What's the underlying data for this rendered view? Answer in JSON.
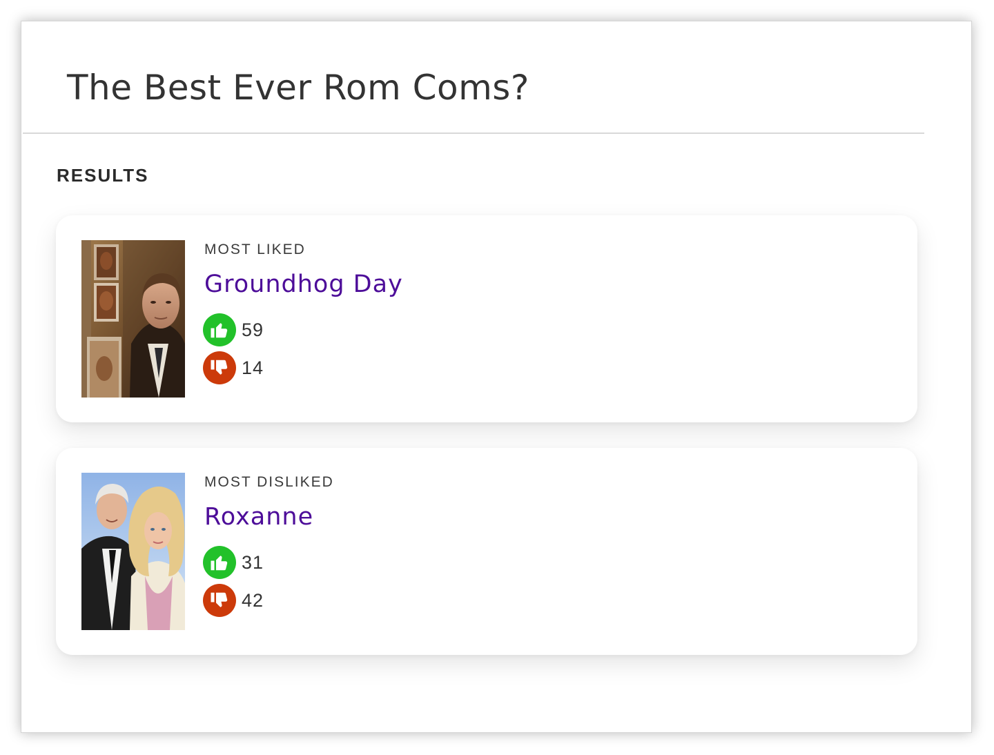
{
  "page": {
    "title": "The Best Ever Rom Coms?",
    "results_label": "RESULTS"
  },
  "colors": {
    "like": "#22c12a",
    "dislike": "#cc3a0a",
    "movie_title": "#4d0d99"
  },
  "results": [
    {
      "label": "MOST LIKED",
      "title": "Groundhog Day",
      "likes": "59",
      "dislikes": "14",
      "poster_icon": "groundhog-day-poster"
    },
    {
      "label": "MOST DISLIKED",
      "title": "Roxanne",
      "likes": "31",
      "dislikes": "42",
      "poster_icon": "roxanne-poster"
    }
  ]
}
